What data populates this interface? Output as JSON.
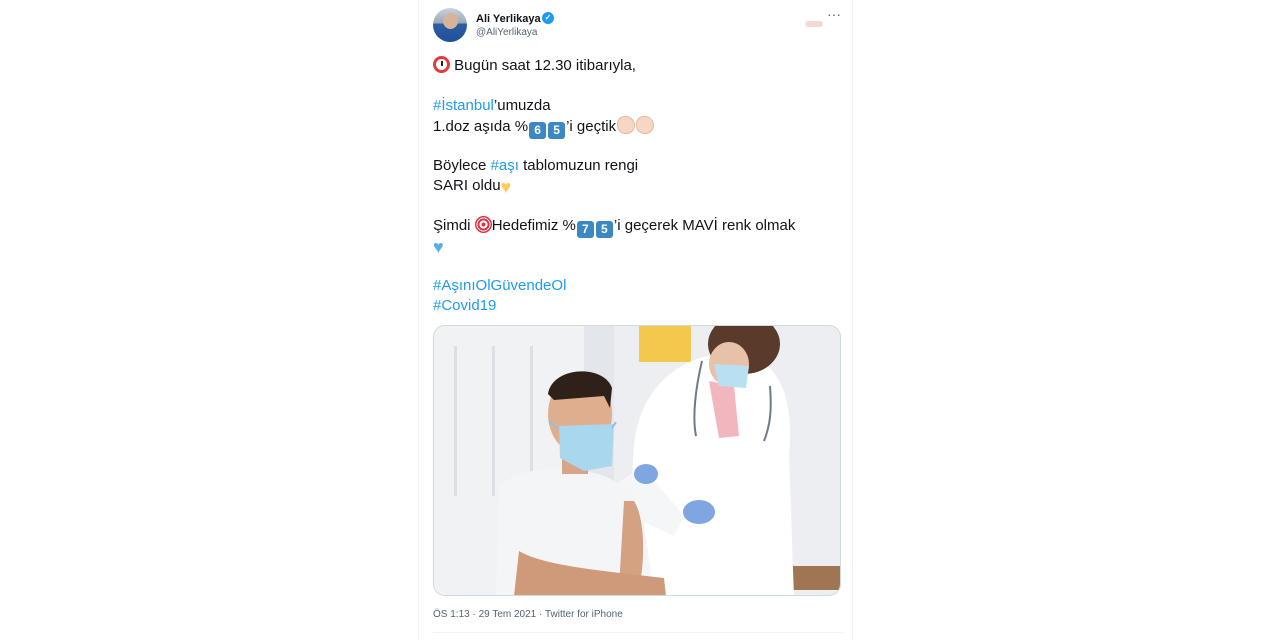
{
  "author": {
    "name": "Ali Yerlikaya",
    "handle": "@AliYerlikaya",
    "verified_icon": "verified-badge-icon",
    "more_label": "···"
  },
  "tweet": {
    "l1": "Bugün saat 12.30 itibarıyla,",
    "l2_tag": "#İstanbul",
    "l2_rest": "’umuzda",
    "l3_pre": "1.doz aşıda %",
    "l3_d1": "6",
    "l3_d2": "5",
    "l3_post": "’i geçtik",
    "l4_pre": "Böylece ",
    "l4_tag": "#aşı",
    "l4_rest": " tablomuzun rengi",
    "l5": "SARI oldu",
    "l6_pre": "Şimdi ",
    "l6_mid": "Hedefimiz %",
    "l6_d1": "7",
    "l6_d2": "5",
    "l6_post": "’i geçerek MAVİ renk olmak",
    "tag1": "#AşınıOlGüvendeOl",
    "tag2": "#Covid19"
  },
  "meta": {
    "time": "ÖS 1:13",
    "sep1": " · ",
    "date": "29 Tem 2021",
    "sep2": " · ",
    "source": "Twitter for iPhone"
  },
  "colors": {
    "link": "#1d9bf0",
    "secondary_text": "#536471",
    "keycap": "#3b88c3"
  }
}
